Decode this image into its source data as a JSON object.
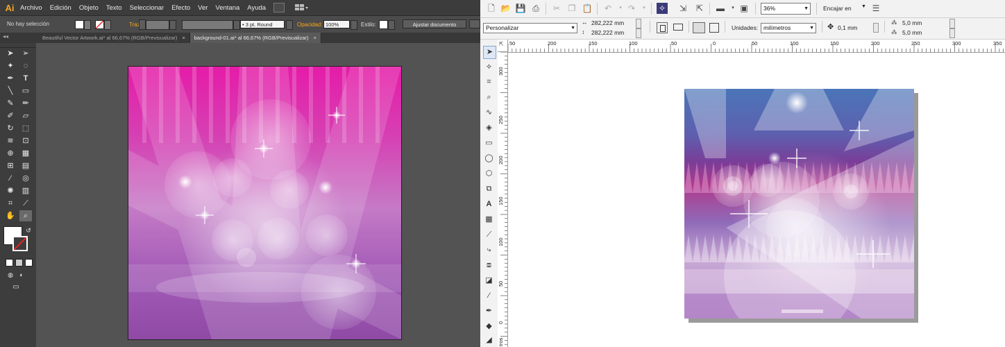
{
  "illustrator": {
    "logo": "Ai",
    "menu": [
      "Archivo",
      "Edición",
      "Objeto",
      "Texto",
      "Seleccionar",
      "Efecto",
      "Ver",
      "Ventana",
      "Ayuda"
    ],
    "control": {
      "selection": "No hay selección",
      "stroke_label": "Trazo:",
      "brush": "3 pt. Round",
      "opacity_label": "Opacidad:",
      "opacity_value": "100%",
      "style_label": "Estilo:",
      "adjust_button": "Ajustar documento"
    },
    "tabs": [
      {
        "label": "Beautiful Vector Artwork.ai* al 66,67% (RGB/Previsualizar)",
        "active": false
      },
      {
        "label": "background-01.ai* al 66,67% (RGB/Previsualizar)",
        "active": true
      }
    ],
    "accent": "#f7a823"
  },
  "corel": {
    "zoom": "36%",
    "fit_label": "Encajar en",
    "page_preset": "Personalizar",
    "width": "282,222 mm",
    "height": "282,222 mm",
    "units_label": "Unidades:",
    "units_value": "milímetros",
    "nudge": "0,1 mm",
    "dup_x": "5,0 mm",
    "dup_y": "5,0 mm",
    "h_ruler": [
      "50",
      "200",
      "150",
      "100",
      "50",
      "0",
      "50",
      "100",
      "150",
      "200",
      "250",
      "300",
      "350"
    ],
    "v_ruler": [
      "300",
      "250",
      "200",
      "150",
      "100",
      "50",
      "0"
    ],
    "v_ruler_bottom": "tros"
  }
}
